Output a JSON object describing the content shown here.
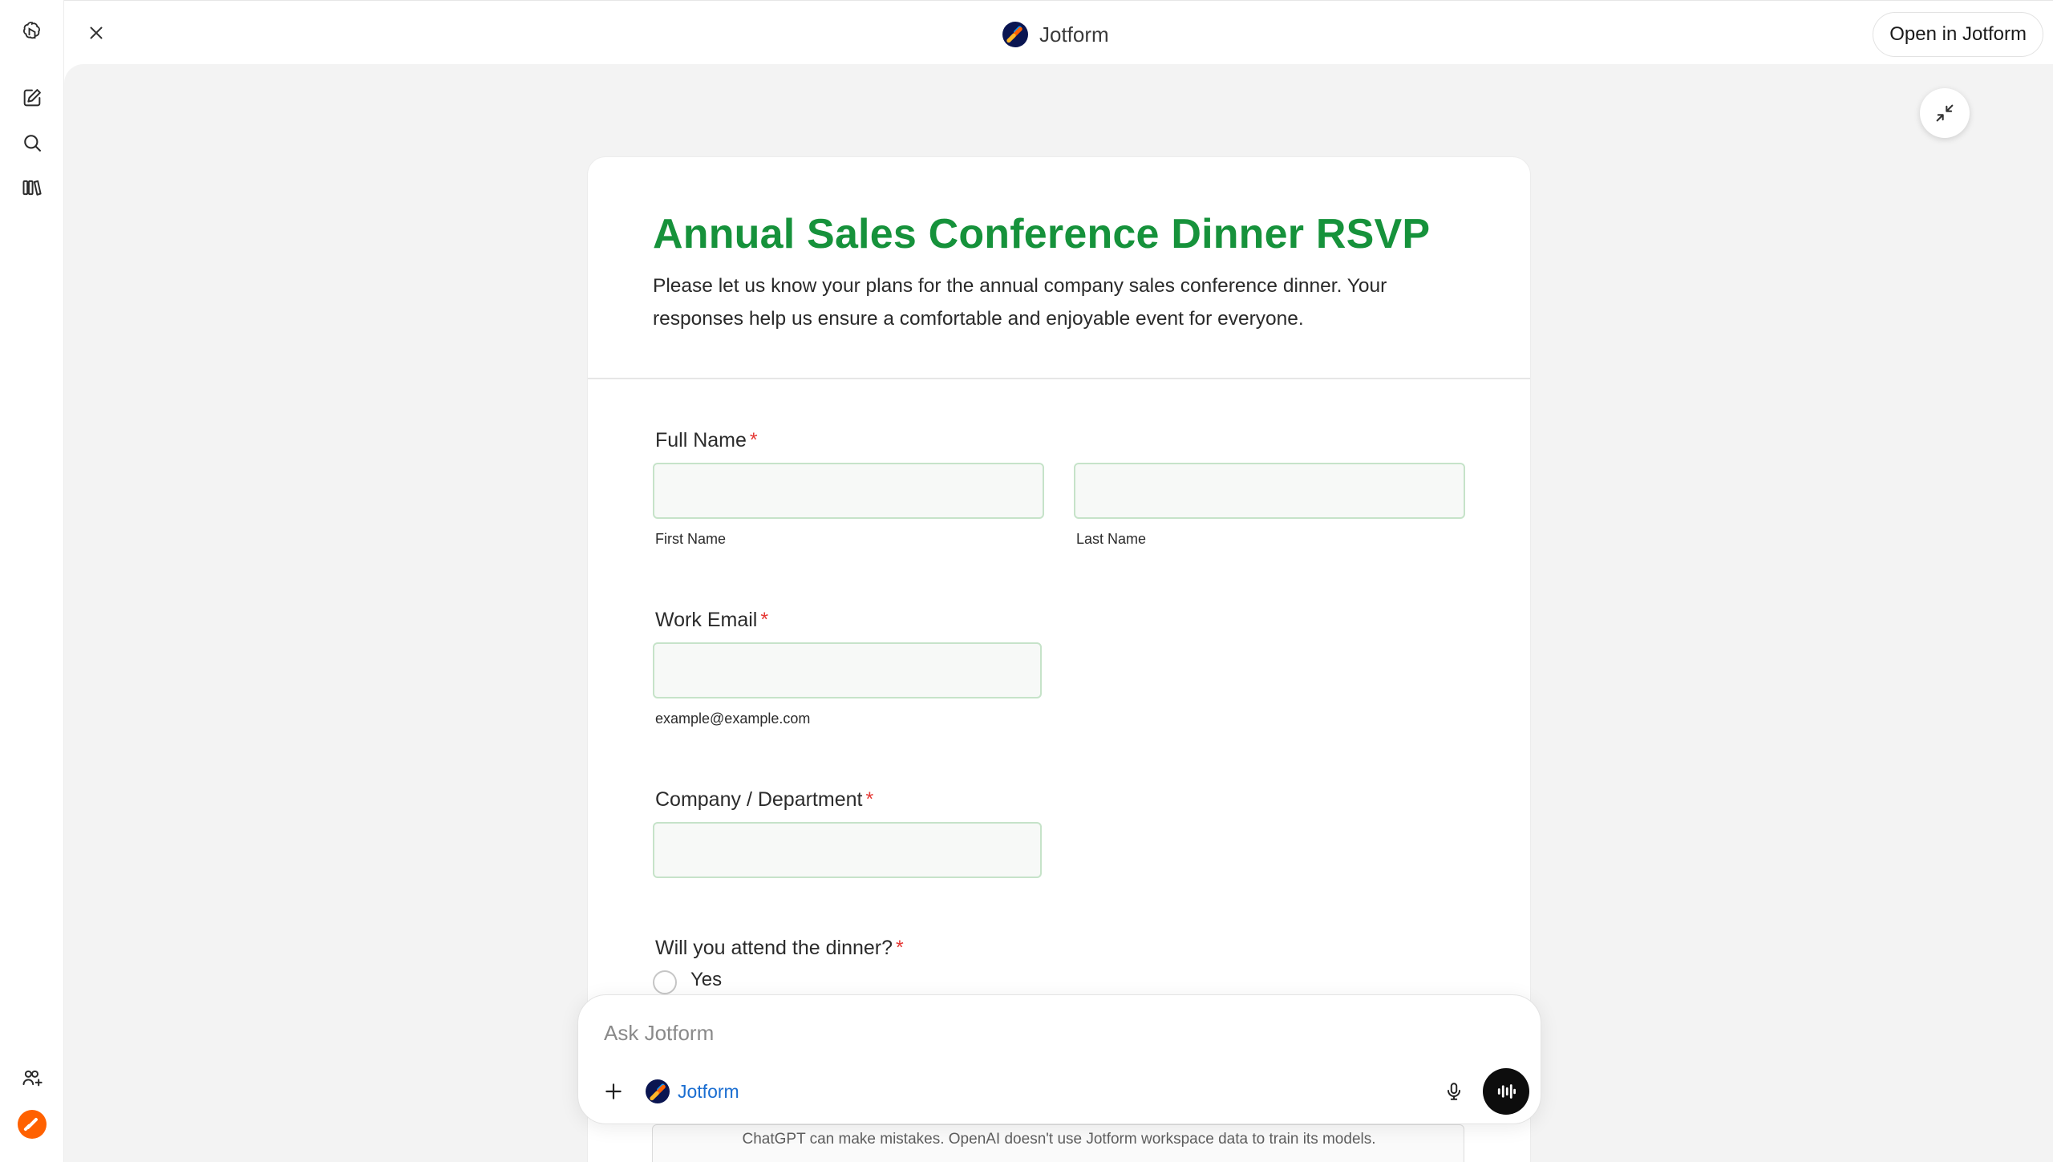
{
  "topbar": {
    "title": "Jotform",
    "open_button": "Open in Jotform"
  },
  "form": {
    "title": "Annual Sales Conference Dinner RSVP",
    "description": "Please let us know your plans for the annual company sales conference dinner. Your responses help us ensure a comfortable and enjoyable event for everyone.",
    "full_name": {
      "label": "Full Name",
      "required": "*",
      "first_sub": "First Name",
      "last_sub": "Last Name"
    },
    "work_email": {
      "label": "Work Email",
      "required": "*",
      "sub": "example@example.com"
    },
    "company": {
      "label": "Company / Department",
      "required": "*"
    },
    "attend": {
      "label": "Will you attend the dinner?",
      "required": "*",
      "options": [
        "Yes"
      ]
    }
  },
  "composer": {
    "placeholder": "Ask Jotform",
    "app_chip": "Jotform"
  },
  "disclaimer": "ChatGPT can make mistakes. OpenAI doesn't use Jotform workspace data to train its models.",
  "colors": {
    "title_green": "#16923b",
    "required_red": "#e53935",
    "chip_blue": "#1b6ed1",
    "jotform_navy": "#0a1551",
    "jotform_orange": "#ff6100"
  },
  "icons": {
    "rail": [
      "openai-logo-icon",
      "new-chat-icon",
      "search-icon",
      "library-icon",
      "add-people-icon",
      "jotform-app-icon"
    ],
    "topbar": [
      "close-icon",
      "jotform-logo-icon",
      "collapse-icon"
    ],
    "composer": [
      "plus-icon",
      "jotform-logo-icon",
      "microphone-icon",
      "voice-mode-icon"
    ]
  }
}
